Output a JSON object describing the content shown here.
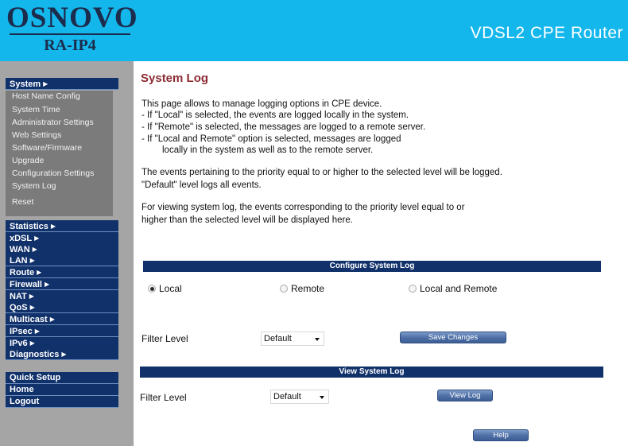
{
  "header": {
    "logo_main": "OSNOVO",
    "logo_sub": "RA-IP4",
    "title": "VDSL2 CPE Router"
  },
  "sidebar": {
    "system_label": "System",
    "system_items": [
      "Host Name Config",
      "System Time",
      "Administrator Settings",
      "Web Settings",
      "Software/Firmware",
      "Upgrade",
      "Configuration Settings",
      "System Log",
      "Reset"
    ],
    "menus": [
      "Statistics",
      "xDSL",
      "WAN",
      "LAN",
      "Route",
      "Firewall",
      "NAT",
      "QoS",
      "Multicast",
      "IPsec",
      "IPv6",
      "Diagnostics"
    ],
    "bottom": [
      "Quick Setup",
      "Home",
      "Logout"
    ]
  },
  "main": {
    "title": "System Log",
    "desc": [
      "This page allows to manage logging options in CPE device.",
      " - If \"Local\" is selected, the events are logged locally in the system.",
      " - If \"Remote\" is selected, the messages are logged to a remote server.",
      " - If \"Local and Remote\" option is selected, messages are logged",
      "      locally in the system as well as to the remote server.",
      "The events pertaining to the priority equal to or higher to the selected level will be logged.",
      "\"Default\" level logs all events.",
      "For viewing system log, the events corresponding to the priority level equal to or",
      "higher than the selected level will be displayed here."
    ],
    "configure": {
      "heading": "Configure System Log",
      "options": [
        "Local",
        "Remote",
        "Local and Remote"
      ],
      "selected": "Local",
      "filter_label": "Filter Level",
      "filter_value": "Default",
      "save_label": "Save Changes"
    },
    "view": {
      "heading": "View System Log",
      "filter_label": "Filter Level",
      "filter_value": "Default",
      "view_label": "View Log"
    },
    "help_label": "Help"
  }
}
